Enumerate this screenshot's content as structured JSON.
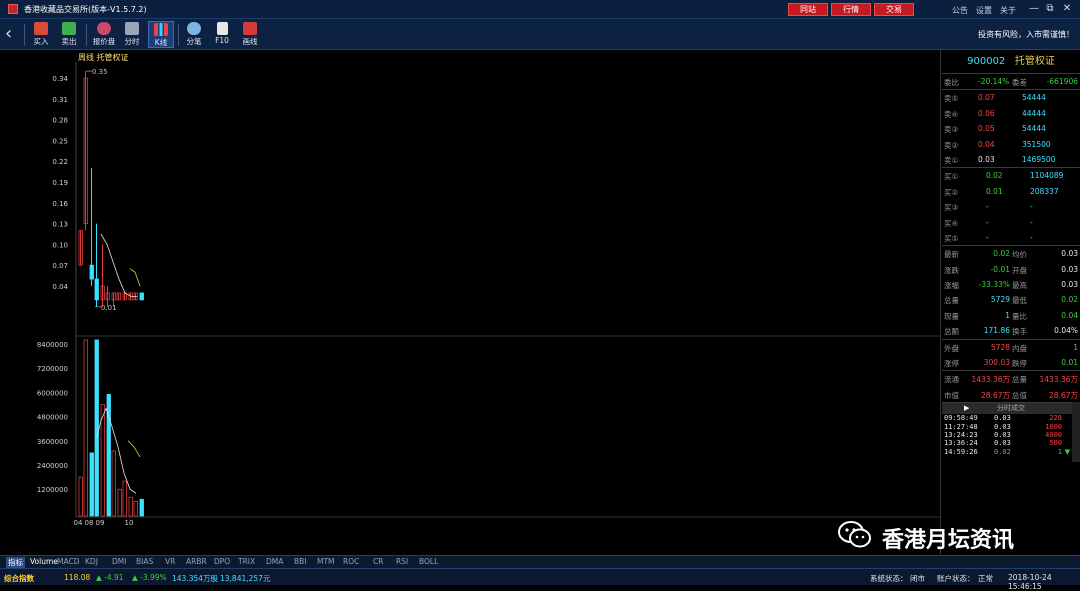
{
  "app": {
    "title": "香港收藏品交易所(版本-V1.5.7.2)",
    "top_buttons": [
      "同站",
      "行情",
      "交易"
    ],
    "top_links": [
      "公告",
      "设置",
      "关于"
    ],
    "window_controls": [
      "—",
      "⧉",
      "✕"
    ]
  },
  "toolbar": {
    "items": [
      {
        "label": "买入",
        "icon": "buy-icon",
        "color": "#d84a3a"
      },
      {
        "label": "卖出",
        "icon": "sell-icon",
        "color": "#3fb052"
      },
      {
        "label": "报价盘",
        "icon": "quote-icon",
        "color": "#c84b6a"
      },
      {
        "label": "分时",
        "icon": "timeshare-icon",
        "color": "#9aa6b8"
      },
      {
        "label": "K线",
        "icon": "kline-icon",
        "color": "#d8e2f0"
      },
      {
        "label": "分笔",
        "icon": "pie-icon",
        "color": "#7fb3e0"
      },
      {
        "label": "F10",
        "icon": "document-icon",
        "color": "#e8e8e8"
      },
      {
        "label": "画线",
        "icon": "drawline-icon",
        "color": "#d33a3a"
      }
    ],
    "risk_notice": "投资有风险，入市需谨慎！"
  },
  "chart": {
    "period_label": "周线  托管权证",
    "price_axis": [
      "0.34",
      "0.31",
      "0.28",
      "0.25",
      "0.22",
      "0.19",
      "0.16",
      "0.13",
      "0.10",
      "0.07",
      "0.04"
    ],
    "max_label": "0.35",
    "min_label": "0.01",
    "volume_axis": [
      "8400000",
      "7200000",
      "6000000",
      "4800000",
      "3600000",
      "2400000",
      "1200000"
    ],
    "x_labels": [
      "04",
      "08",
      "09",
      "10"
    ]
  },
  "tabs": [
    "指标",
    "Volume",
    "MACD",
    "KDJ",
    "DMI",
    "BIAS",
    "VR",
    "ARBR",
    "DPO",
    "TRIX",
    "DMA",
    "BBI",
    "MTM",
    "ROC",
    "CR",
    "RSI",
    "BOLL"
  ],
  "status": {
    "index_label": "综合指数",
    "index_value": "118.08",
    "change": "▲ -4.91",
    "change_pct": "▲ -3.99%",
    "turnover": "143.354万股",
    "amount": "13,841,257元",
    "system_status_label": "系统状态：",
    "system_status": "闭市",
    "account_status_label": "账户状态：",
    "account_status": "正常",
    "datetime": "2018-10-24 15:46:15"
  },
  "quote": {
    "code": "900002",
    "name": "托管权证",
    "weibi_label": "委比",
    "weibi": "-20.14%",
    "weicha_label": "委差",
    "weicha": "-661906",
    "asks": [
      {
        "label": "卖⑤",
        "price": "0.07",
        "vol": "54444"
      },
      {
        "label": "卖④",
        "price": "0.06",
        "vol": "44444"
      },
      {
        "label": "卖③",
        "price": "0.05",
        "vol": "54444"
      },
      {
        "label": "卖②",
        "price": "0.04",
        "vol": "351500"
      },
      {
        "label": "卖①",
        "price": "0.03",
        "vol": "1469500"
      }
    ],
    "bids": [
      {
        "label": "买①",
        "price": "0.02",
        "vol": "1104089"
      },
      {
        "label": "买②",
        "price": "0.01",
        "vol": "208337"
      },
      {
        "label": "买③",
        "price": "-",
        "vol": "-"
      },
      {
        "label": "买④",
        "price": "-",
        "vol": "-"
      },
      {
        "label": "买⑤",
        "price": "-",
        "vol": "-"
      }
    ],
    "stats": [
      {
        "l1": "最新",
        "v1": "0.02",
        "c1": "green",
        "l2": "均价",
        "v2": "0.03",
        "c2": "white"
      },
      {
        "l1": "涨跌",
        "v1": "-0.01",
        "c1": "green",
        "l2": "开盘",
        "v2": "0.03",
        "c2": "white"
      },
      {
        "l1": "涨幅",
        "v1": "-33.33%",
        "c1": "green",
        "l2": "最高",
        "v2": "0.03",
        "c2": "white"
      },
      {
        "l1": "总量",
        "v1": "5729",
        "c1": "cyan",
        "l2": "最低",
        "v2": "0.02",
        "c2": "green"
      },
      {
        "l1": "现量",
        "v1": "1",
        "c1": "cyan",
        "l2": "量比",
        "v2": "0.04",
        "c2": "green"
      },
      {
        "l1": "总额",
        "v1": "171.86",
        "c1": "cyan",
        "l2": "换手",
        "v2": "0.04%",
        "c2": "white"
      }
    ],
    "stats2": [
      {
        "l1": "外盘",
        "v1": "5728",
        "c1": "red",
        "l2": "内盘",
        "v2": "1",
        "c2": "green"
      },
      {
        "l1": "涨停",
        "v1": "300.03",
        "c1": "red",
        "l2": "跌停",
        "v2": "0.01",
        "c2": "green"
      }
    ],
    "stats3": [
      {
        "l1": "流通",
        "v1": "1433.36万",
        "c1": "red",
        "l2": "总量",
        "v2": "1433.36万",
        "c2": "red"
      },
      {
        "l1": "市值",
        "v1": "28.67万",
        "c1": "red",
        "l2": "总值",
        "v2": "28.67万",
        "c2": "red"
      }
    ],
    "ticks_title": "分时成交",
    "ticks": [
      {
        "time": "09:58:49",
        "price": "0.03",
        "vol": "228",
        "pc": "white",
        "vc": "red"
      },
      {
        "time": "11:27:48",
        "price": "0.03",
        "vol": "1000",
        "pc": "white",
        "vc": "red"
      },
      {
        "time": "13:24:23",
        "price": "0.03",
        "vol": "4000",
        "pc": "white",
        "vc": "red"
      },
      {
        "time": "13:36:24",
        "price": "0.03",
        "vol": "500",
        "pc": "white",
        "vc": "red"
      },
      {
        "time": "14:59:26",
        "price": "0.02",
        "vol": "1",
        "pc": "green",
        "vc": "green"
      }
    ]
  },
  "watermark": {
    "text": "香港月坛资讯"
  }
}
